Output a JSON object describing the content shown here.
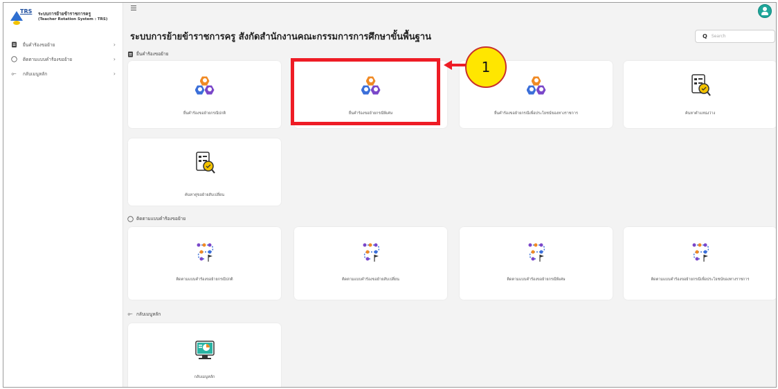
{
  "sidebar": {
    "logo_short": "TRS",
    "logo_line1": "ระบบการย้ายข้าราชการครู",
    "logo_line2": "(Teacher Rotation System : TRS)",
    "items": [
      {
        "label": "ยื่นคำร้องขอย้าย",
        "icon": "file-icon"
      },
      {
        "label": "ติดตามแบบคำร้องขอย้าย",
        "icon": "circle-icon"
      },
      {
        "label": "กลับเมนูหลัก",
        "icon": "back-arrow-icon"
      }
    ]
  },
  "header": {
    "title": "ระบบการย้ายข้าราชการครู สังกัดสำนักงานคณะกรรมการการศึกษาขั้นพื้นฐาน",
    "search_placeholder": "Search"
  },
  "sections": [
    {
      "label": "ยื่นคำร้องขอย้าย",
      "icon": "file-icon"
    },
    {
      "label": "ติดตามแบบคำร้องขอย้าย",
      "icon": "circle-icon"
    },
    {
      "label": "กลับเมนูหลัก",
      "icon": "back-arrow-icon"
    }
  ],
  "cards": {
    "submit": [
      {
        "label": "ยื่นคำร้องขอย้ายกรณีปกติ",
        "icon": "people-hex-icon"
      },
      {
        "label": "ยื่นคำร้องขอย้ายกรณีพิเศษ",
        "icon": "people-hex-icon"
      },
      {
        "label": "ยื่นคำร้องขอย้ายกรณีเพื่อประโยชน์ของทางราชการ",
        "icon": "people-hex-icon"
      },
      {
        "label": "ค้นหาตำแหน่งว่าง",
        "icon": "document-search-icon"
      },
      {
        "label": "ค้นหาคู่ขอย้ายสับเปลี่ยน",
        "icon": "document-search-icon"
      }
    ],
    "track": [
      {
        "label": "ติดตามแบบคำร้องขอย้ายกรณีปกติ",
        "icon": "route-icon"
      },
      {
        "label": "ติดตามแบบคำร้องขอย้ายสับเปลี่ยน",
        "icon": "route-icon"
      },
      {
        "label": "ติดตามแบบคำร้องขอย้ายกรณีพิเศษ",
        "icon": "route-icon"
      },
      {
        "label": "ติดตามแบบคำร้องขอย้ายกรณีเพื่อประโยชน์ของทางราชการ",
        "icon": "route-icon"
      }
    ],
    "home": [
      {
        "label": "กลับเมนูหลัก",
        "icon": "monitor-chart-icon"
      }
    ]
  },
  "annotation": {
    "number": "1",
    "color": "#ee1c25",
    "callout_color": "#ffe600"
  },
  "colors": {
    "accent": "#1fa69a",
    "hex_orange": "#f08a24",
    "hex_blue": "#3b6fd9",
    "hex_purple": "#7a47c9"
  }
}
